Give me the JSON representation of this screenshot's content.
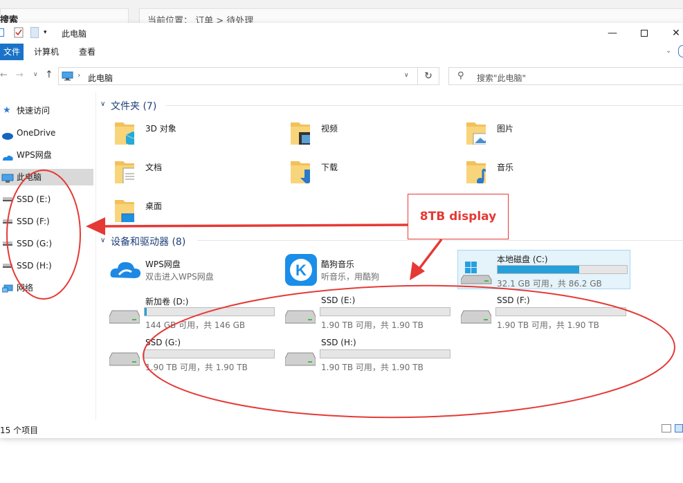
{
  "background_app": {
    "search_label": "搜索",
    "breadcrumb": "当前位置： 订单 > 待处理"
  },
  "window": {
    "title": "此电脑",
    "ribbon_tabs": [
      "文件",
      "计算机",
      "查看"
    ],
    "address": "此电脑",
    "search_placeholder": "搜索\"此电脑\""
  },
  "sidebar": {
    "items": [
      {
        "label": "快速访问",
        "icon": "star-icon"
      },
      {
        "label": "OneDrive",
        "icon": "cloud-icon"
      },
      {
        "label": "WPS网盘",
        "icon": "wps-cloud-icon"
      },
      {
        "label": "此电脑",
        "icon": "pc-icon"
      },
      {
        "label": "SSD (E:)",
        "icon": "drive-icon"
      },
      {
        "label": "SSD (F:)",
        "icon": "drive-icon"
      },
      {
        "label": "SSD (G:)",
        "icon": "drive-icon"
      },
      {
        "label": "SSD (H:)",
        "icon": "drive-icon"
      },
      {
        "label": "网络",
        "icon": "network-icon"
      }
    ],
    "selected": "此电脑"
  },
  "folders": {
    "header": "文件夹 (7)",
    "items": [
      {
        "label": "3D 对象",
        "overlay": "cube"
      },
      {
        "label": "视频",
        "overlay": "film"
      },
      {
        "label": "图片",
        "overlay": "picture"
      },
      {
        "label": "文档",
        "overlay": "doc"
      },
      {
        "label": "下载",
        "overlay": "download"
      },
      {
        "label": "音乐",
        "overlay": "music"
      },
      {
        "label": "桌面",
        "overlay": "desktop"
      }
    ]
  },
  "devices": {
    "header": "设备和驱动器 (8)",
    "apps": [
      {
        "name": "WPS网盘",
        "desc": "双击进入WPS网盘",
        "accent": "#1e88e5"
      },
      {
        "name": "酷狗音乐",
        "desc": "听音乐，用酷狗",
        "accent": "#1a8ee8"
      }
    ],
    "drives": [
      {
        "name": "本地磁盘 (C:)",
        "space": "32.1 GB 可用，共 86.2 GB",
        "used_fraction": 0.63,
        "os": true
      },
      {
        "name": "新加卷 (D:)",
        "space": "144 GB 可用，共 146 GB",
        "used_fraction": 0.015
      },
      {
        "name": "SSD (E:)",
        "space": "1.90 TB 可用，共 1.90 TB",
        "used_fraction": 0.0
      },
      {
        "name": "SSD (F:)",
        "space": "1.90 TB 可用，共 1.90 TB",
        "used_fraction": 0.0
      },
      {
        "name": "SSD (G:)",
        "space": "1.90 TB 可用，共 1.90 TB",
        "used_fraction": 0.0
      },
      {
        "name": "SSD (H:)",
        "space": "1.90 TB 可用，共 1.90 TB",
        "used_fraction": 0.0
      }
    ]
  },
  "status": {
    "count": "15 个项目"
  },
  "annotation": {
    "callout": "8TB display",
    "color": "#e53935"
  }
}
